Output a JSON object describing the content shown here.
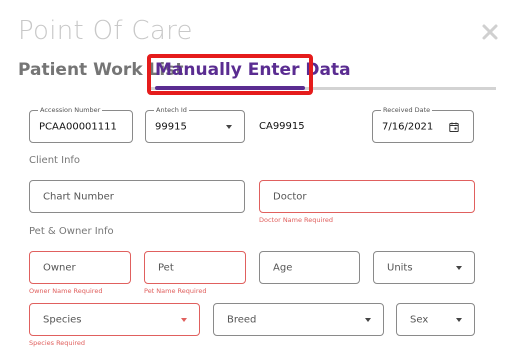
{
  "dialog": {
    "title": "Point Of Care"
  },
  "tabs": [
    {
      "label": "Patient Work List",
      "active": false
    },
    {
      "label": "Manually Enter Data",
      "active": true
    }
  ],
  "fields": {
    "accession": {
      "label": "Accession Number",
      "value": "PCAA00001111"
    },
    "antech": {
      "label": "Antech Id",
      "value": "99915"
    },
    "account": {
      "value": "CA99915"
    },
    "received": {
      "label": "Received Date",
      "value": "7/16/2021"
    },
    "chart_number": {
      "placeholder": "Chart Number"
    },
    "doctor": {
      "placeholder": "Doctor",
      "error": "Doctor Name Required"
    },
    "owner": {
      "placeholder": "Owner",
      "error": "Owner Name Required"
    },
    "pet": {
      "placeholder": "Pet",
      "error": "Pet Name Required"
    },
    "age": {
      "placeholder": "Age"
    },
    "units": {
      "placeholder": "Units"
    },
    "species": {
      "placeholder": "Species",
      "error": "Species Required"
    },
    "breed": {
      "placeholder": "Breed"
    },
    "sex": {
      "placeholder": "Sex"
    }
  },
  "sections": {
    "client": "Client Info",
    "pet_owner": "Pet & Owner Info"
  },
  "colors": {
    "accent": "#5a2c91",
    "error": "#e0605e",
    "highlight": "#e51c1c",
    "title": "#c8c8c8"
  },
  "icons": {
    "close": "close-icon",
    "calendar": "calendar-icon",
    "dropdown": "chevron-down-icon"
  }
}
